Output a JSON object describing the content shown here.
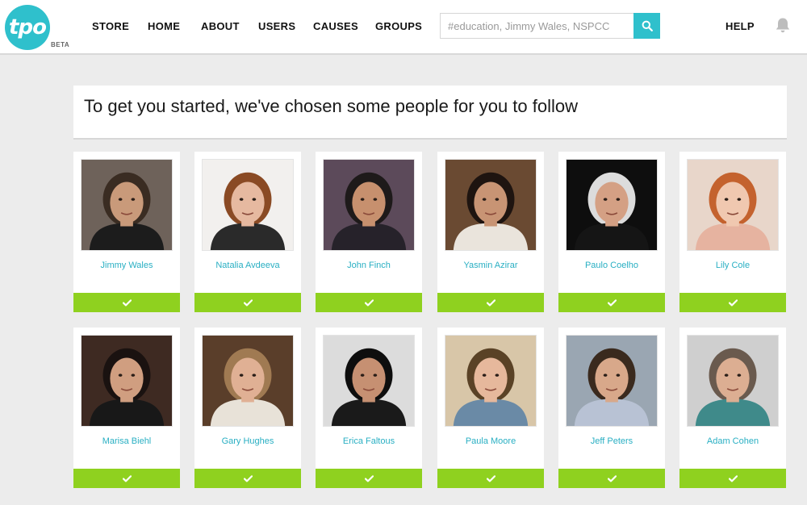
{
  "brand": {
    "logo_text": "tpo",
    "beta_label": "BETA"
  },
  "nav": [
    {
      "label": "STORE",
      "name": "nav-store"
    },
    {
      "label": "HOME",
      "name": "nav-home"
    },
    {
      "label": "ABOUT",
      "name": "nav-about"
    },
    {
      "label": "USERS",
      "name": "nav-users"
    },
    {
      "label": "CAUSES",
      "name": "nav-causes"
    },
    {
      "label": "GROUPS",
      "name": "nav-groups"
    }
  ],
  "search": {
    "placeholder": "#education, Jimmy Wales, NSPCC",
    "value": ""
  },
  "help_label": "HELP",
  "banner": {
    "title": "To get you started, we've chosen some people for you to follow"
  },
  "people": [
    {
      "name": "Jimmy Wales",
      "bg": "#6e625a",
      "skin": "#c99a7a",
      "hair": "#3a2c22",
      "shirt": "#1c1c1c"
    },
    {
      "name": "Natalia Avdeeva",
      "bg": "#f2f0ee",
      "skin": "#e6b9a0",
      "hair": "#8a4a24",
      "shirt": "#2a2a2a"
    },
    {
      "name": "John Finch",
      "bg": "#5c4a5a",
      "skin": "#c7906e",
      "hair": "#1e1a1a",
      "shirt": "#26222a"
    },
    {
      "name": "Yasmin Azirar",
      "bg": "#6a4a32",
      "skin": "#c89474",
      "hair": "#1e1410",
      "shirt": "#eae4dc"
    },
    {
      "name": "Paulo Coelho",
      "bg": "#0e0e0e",
      "skin": "#d4a084",
      "hair": "#dcdcdc",
      "shirt": "#151515"
    },
    {
      "name": "Lily Cole",
      "bg": "#e8d6ca",
      "skin": "#f0c8b0",
      "hair": "#c4622e",
      "shirt": "#e6b3a0"
    },
    {
      "name": "Marisa Biehl",
      "bg": "#3e2a22",
      "skin": "#d09e80",
      "hair": "#1a1210",
      "shirt": "#181818"
    },
    {
      "name": "Gary Hughes",
      "bg": "#5a3e2a",
      "skin": "#e0b094",
      "hair": "#a07a52",
      "shirt": "#e8e2d8"
    },
    {
      "name": "Erica Faltous",
      "bg": "#dcdcdc",
      "skin": "#c69072",
      "hair": "#0e0e0e",
      "shirt": "#1a1a1a"
    },
    {
      "name": "Paula Moore",
      "bg": "#d8c6a8",
      "skin": "#e6b89c",
      "hair": "#5a4226",
      "shirt": "#6a8aa6"
    },
    {
      "name": "Jeff Peters",
      "bg": "#9aa6b2",
      "skin": "#d8a88a",
      "hair": "#3a2a1e",
      "shirt": "#b8c2d4"
    },
    {
      "name": "Adam Cohen",
      "bg": "#cfcfcf",
      "skin": "#dcae92",
      "hair": "#6a5a4e",
      "shirt": "#3f8a8a"
    }
  ],
  "icons": {
    "search": "search-icon",
    "bell": "bell-icon",
    "follow": "checkmark-icon"
  },
  "colors": {
    "brand": "#2fc0cc",
    "follow_green": "#8fd11f",
    "name_link": "#29afc3"
  }
}
